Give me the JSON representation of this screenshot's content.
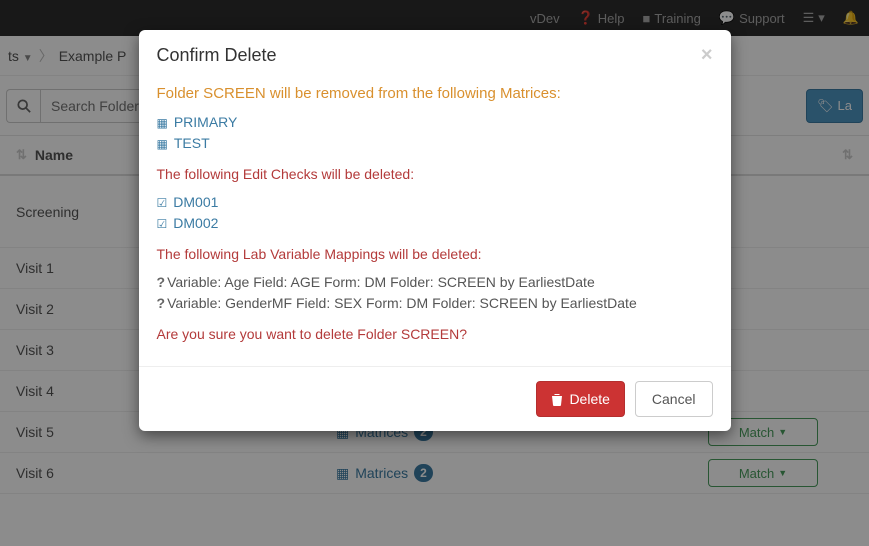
{
  "topnav": {
    "vdev": "vDev",
    "help": "Help",
    "training": "Training",
    "support": "Support"
  },
  "breadcrumb": {
    "root_suffix": "ts",
    "project": "Example P"
  },
  "filter": {
    "search_placeholder": "Search Folders",
    "layout_label": "La"
  },
  "table": {
    "name_header": "Name",
    "rows": [
      {
        "name": "Screening"
      },
      {
        "name": "Visit 1"
      },
      {
        "name": "Visit 2"
      },
      {
        "name": "Visit 3"
      },
      {
        "name": "Visit 4"
      },
      {
        "name": "Visit 5",
        "matrices_label": "Matrices",
        "matrices_count": 2,
        "match_label": "Match"
      },
      {
        "name": "Visit 6",
        "matrices_label": "Matrices",
        "matrices_count": 2,
        "match_label": "Match"
      }
    ]
  },
  "modal": {
    "title": "Confirm Delete",
    "removed_msg": "Folder SCREEN will be removed from the following Matrices:",
    "matrices": [
      {
        "label": "PRIMARY"
      },
      {
        "label": "TEST"
      }
    ],
    "edit_checks_msg": "The following Edit Checks will be deleted:",
    "edit_checks": [
      {
        "label": "DM001"
      },
      {
        "label": "DM002"
      }
    ],
    "lab_msg": "The following Lab Variable Mappings will be deleted:",
    "lab_vars": [
      "Variable: Age Field: AGE Form: DM Folder: SCREEN by EarliestDate",
      "Variable: GenderMF Field: SEX Form: DM Folder: SCREEN by EarliestDate"
    ],
    "confirm_q": "Are you sure you want to delete Folder SCREEN?",
    "delete_label": "Delete",
    "cancel_label": "Cancel"
  }
}
